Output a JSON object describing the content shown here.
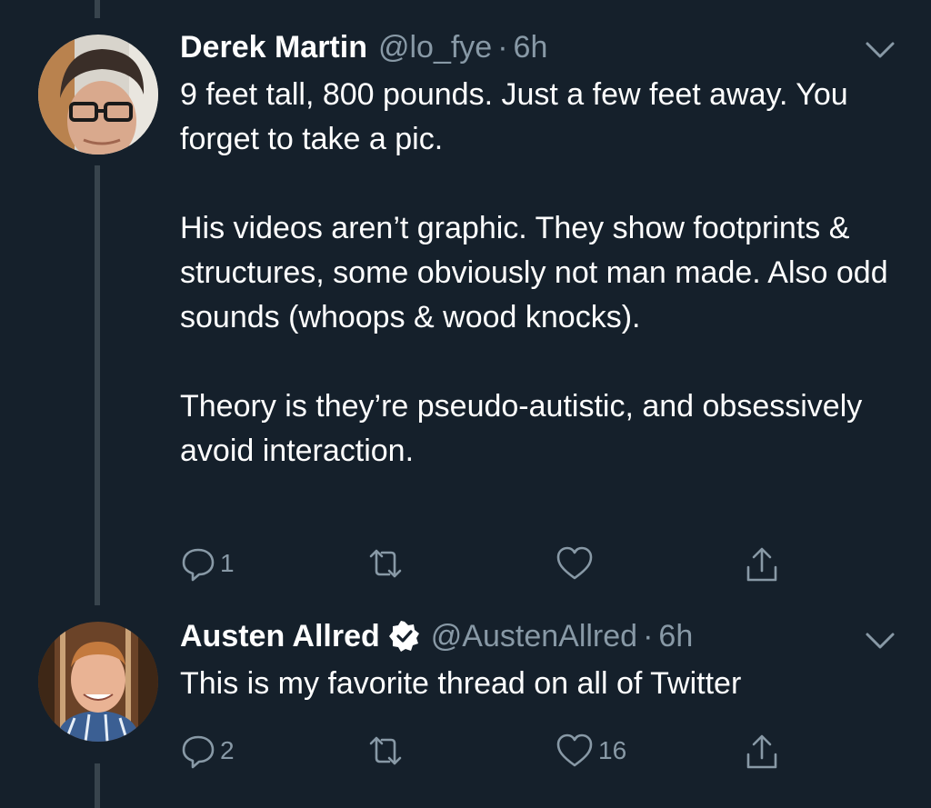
{
  "tweets": [
    {
      "name": "Derek Martin",
      "handle": "@lo_fye",
      "separator": "·",
      "time": "6h",
      "verified": false,
      "paragraphs": [
        "9 feet tall, 800 pounds. Just a few feet away. You forget to take a pic.",
        "His videos aren’t graphic. They show footprints & structures, some obviously not man made. Also odd sounds (whoops & wood knocks).",
        "Theory is they’re pseudo-autistic, and obsessively avoid interaction."
      ],
      "reply_count": "1",
      "retweet_count": "",
      "like_count": ""
    },
    {
      "name": "Austen Allred",
      "handle": "@AustenAllred",
      "separator": "·",
      "time": "6h",
      "verified": true,
      "paragraphs": [
        "This is my favorite thread on all of Twitter"
      ],
      "reply_count": "2",
      "retweet_count": "",
      "like_count": "16"
    }
  ],
  "icons": {
    "reply": "reply-icon",
    "retweet": "retweet-icon",
    "like": "like-icon",
    "share": "share-icon",
    "caret": "chevron-down-icon",
    "verified": "verified-badge-icon"
  },
  "colors": {
    "background": "#15202b",
    "thread_line": "#38444d",
    "secondary_text": "#8899a6",
    "primary_text": "#ffffff",
    "verified_badge": "#ffffff"
  }
}
